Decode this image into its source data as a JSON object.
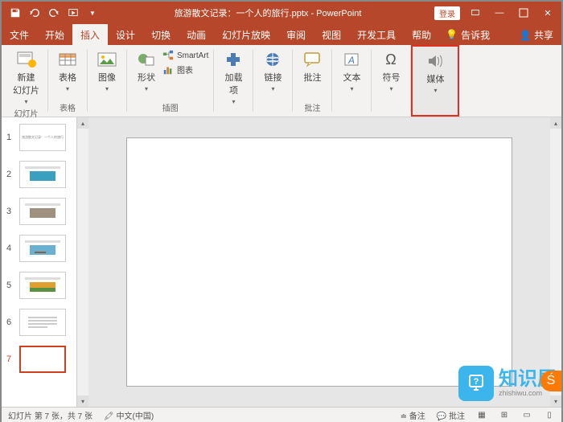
{
  "titlebar": {
    "filename": "旅游散文记录：一个人的旅行.pptx - PowerPoint",
    "login": "登录"
  },
  "tabs": {
    "file": "文件",
    "home": "开始",
    "insert": "插入",
    "design": "设计",
    "transitions": "切换",
    "animations": "动画",
    "slideshow": "幻灯片放映",
    "review": "审阅",
    "view": "视图",
    "developer": "开发工具",
    "help": "帮助",
    "tellme": "告诉我",
    "share": "共享"
  },
  "ribbon": {
    "newslide": "新建\n幻灯片",
    "slides": "幻灯片",
    "table": "表格",
    "tables": "表格",
    "images": "图像",
    "shapes": "形状",
    "smartart": "SmartArt",
    "chart": "图表",
    "illustrations": "插图",
    "addins": "加载\n项",
    "links": "链接",
    "comment": "批注",
    "comments": "批注",
    "text": "文本",
    "symbols": "符号",
    "media": "媒体"
  },
  "thumbs": {
    "nums": [
      "1",
      "2",
      "3",
      "4",
      "5",
      "6",
      "7"
    ]
  },
  "status": {
    "slideinfo": "幻灯片 第 7 张，共 7 张",
    "lang": "中文(中国)",
    "notes": "备注",
    "comments": "批注"
  },
  "watermark": {
    "text": "知识屋",
    "url": "zhishiwu.com"
  }
}
